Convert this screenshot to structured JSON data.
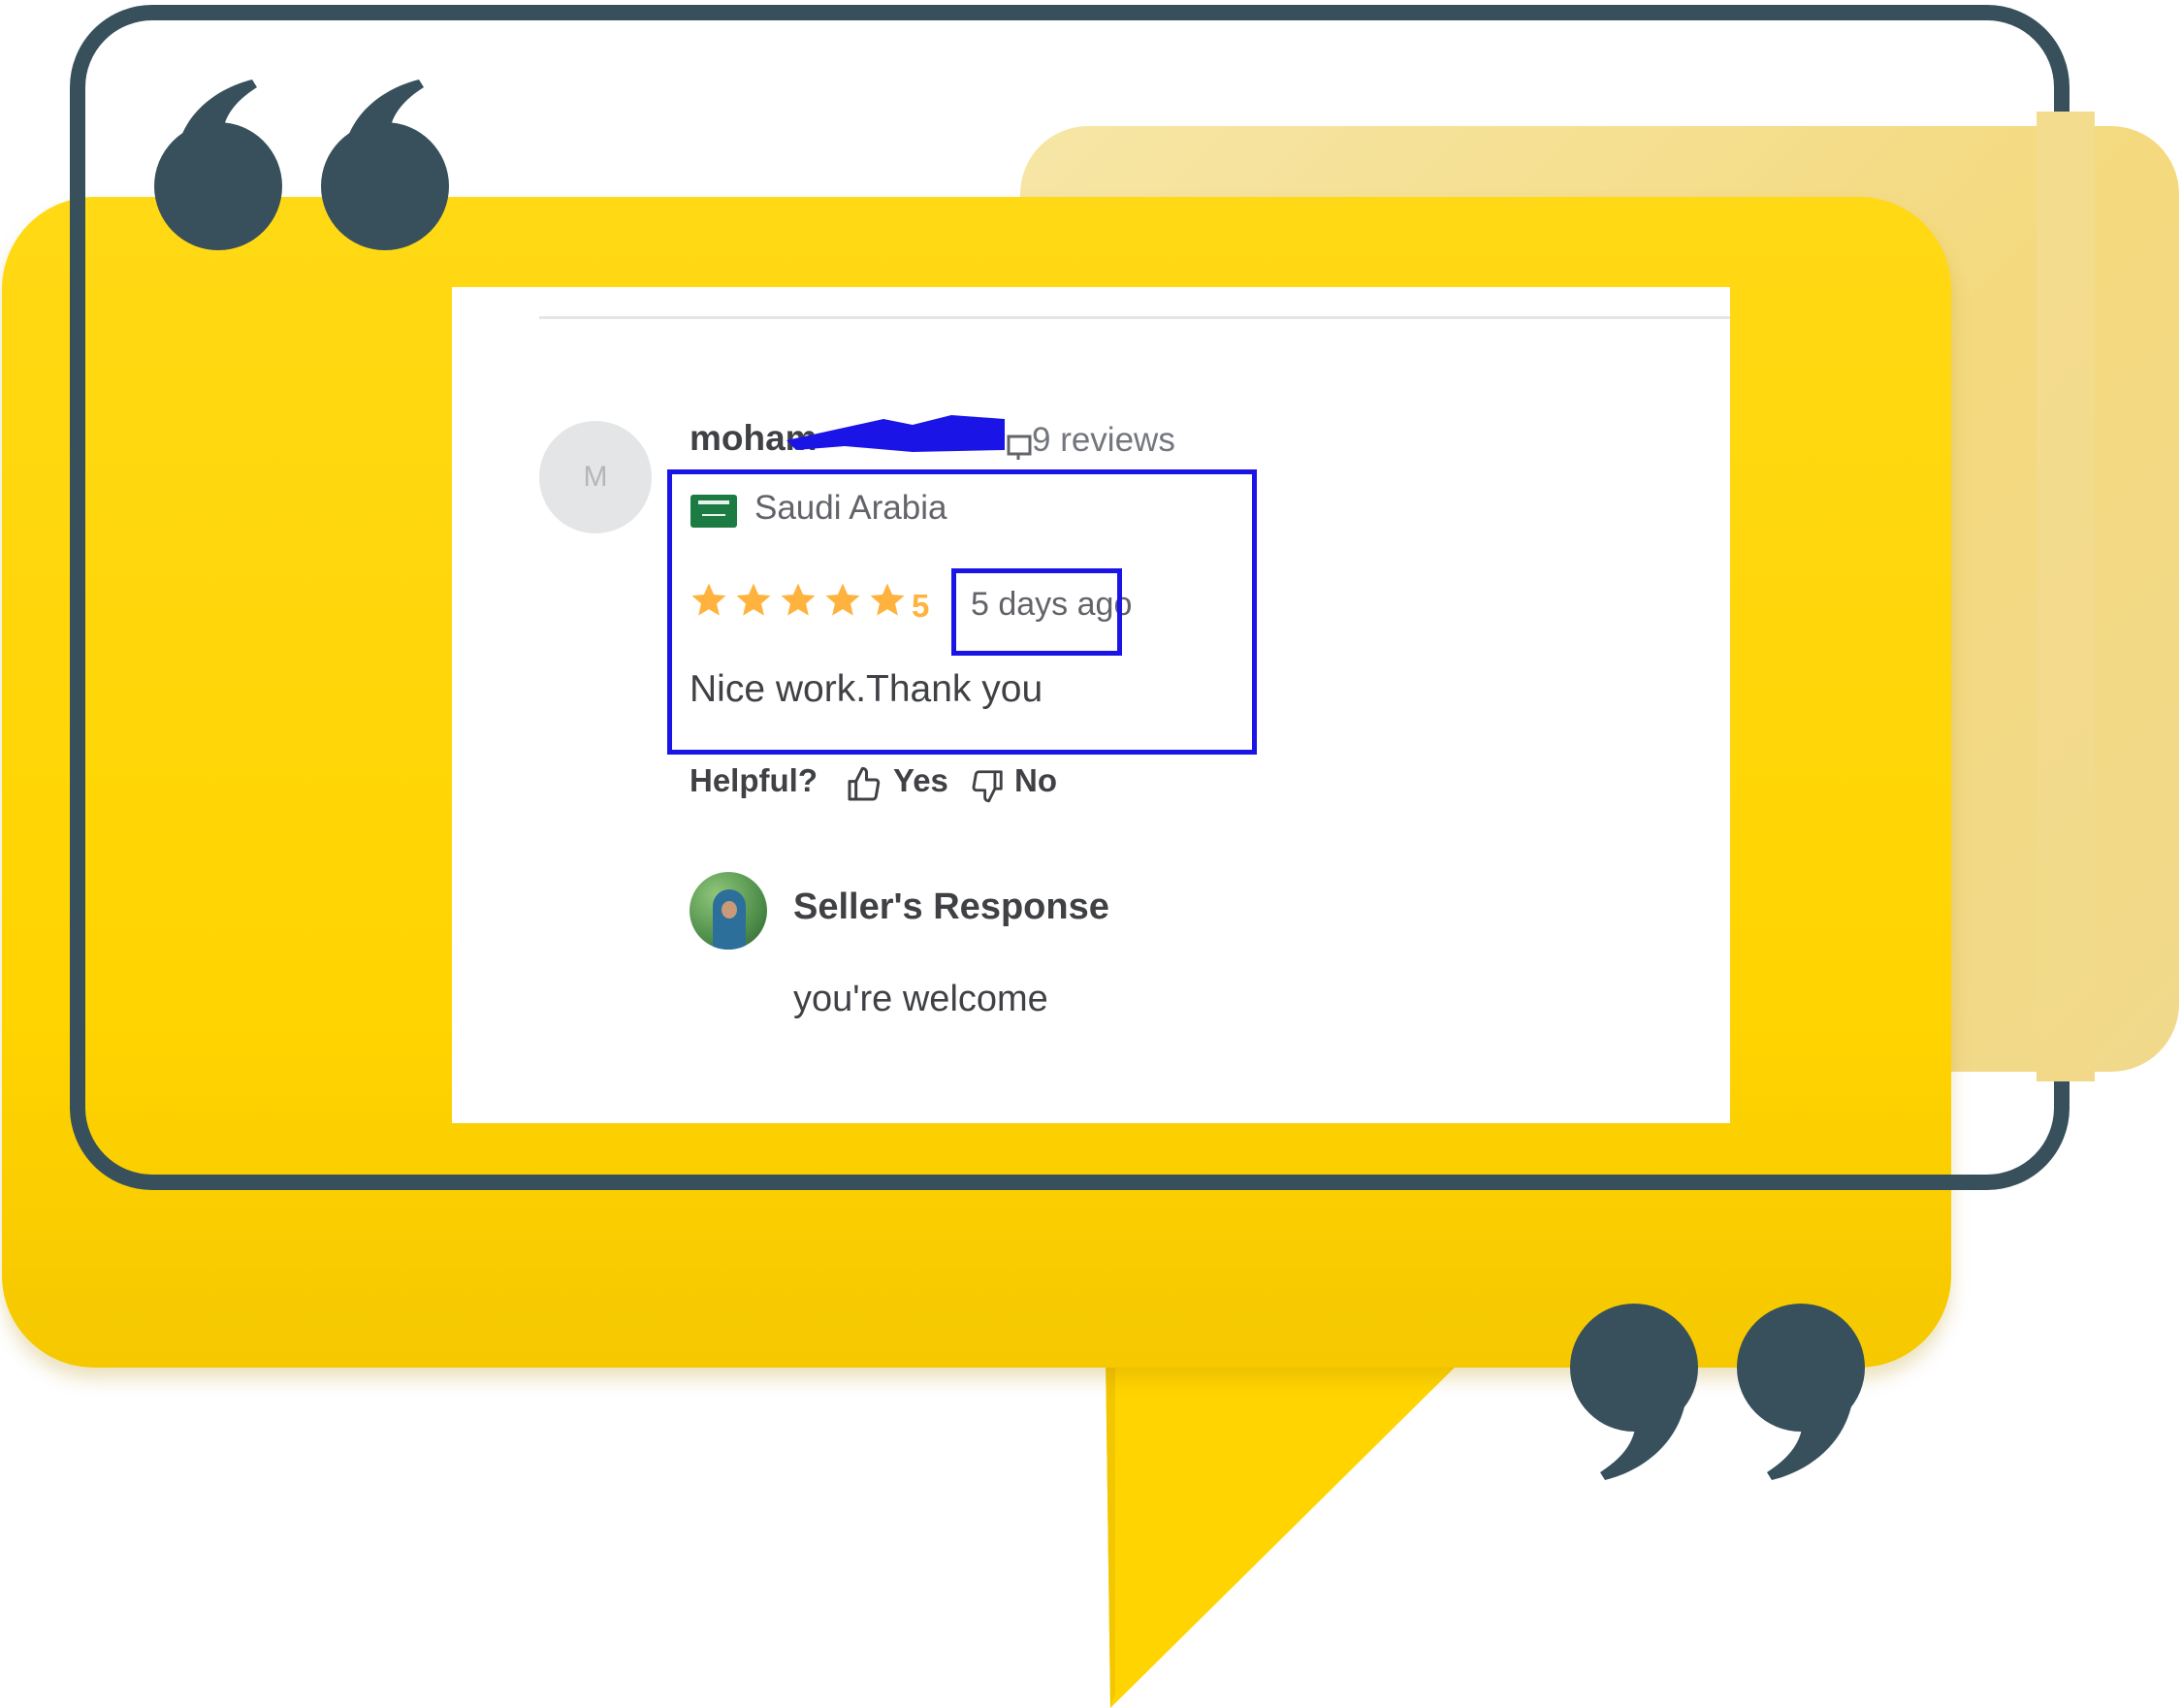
{
  "review": {
    "avatar_initial": "M",
    "username": "moham",
    "reviews_count": "9 reviews",
    "country": "Saudi Arabia",
    "rating": "5",
    "stars": 5,
    "date": "5 days ago",
    "text": "Nice work.Thank you",
    "helpful_label": "Helpful?",
    "yes_label": "Yes",
    "no_label": "No"
  },
  "seller_response": {
    "title": "Seller's Response",
    "text": "you're welcome"
  },
  "colors": {
    "yellow": "#ffd400",
    "pale_yellow": "#f4d97e",
    "frame": "#37505c",
    "star": "#ffb33e",
    "highlight": "#1b14e6"
  },
  "icons": {
    "flag": "saudi-arabia-flag-icon",
    "yes": "thumbs-up-icon",
    "no": "thumbs-down-icon",
    "quote_open": "open-quote-icon",
    "quote_close": "close-quote-icon"
  }
}
